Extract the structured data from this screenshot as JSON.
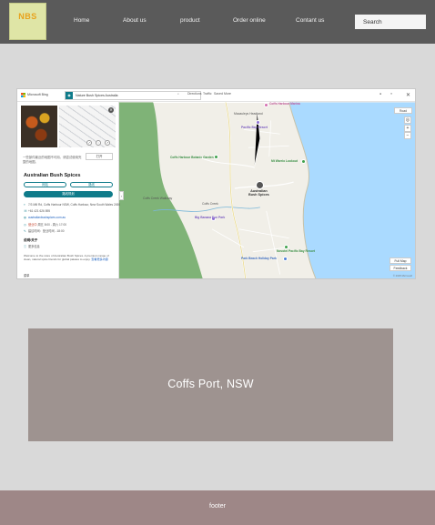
{
  "nav": {
    "logo_text": "NBS",
    "links": [
      "Home",
      "About us",
      "product",
      "Order online",
      "Contant us"
    ],
    "search_placeholder": "Search"
  },
  "map": {
    "brand": "Microsoft Bing",
    "search_text": "Nature Bush Spices Australia",
    "toolbar": [
      "Directions",
      "Traffic",
      "Saved",
      "More"
    ],
    "panel": {
      "note": "一些部件最近的地图不可用。请尝试使用完整的地图。",
      "note_button": "打开",
      "title": "Australian Bush Spices",
      "pill_left": "网站",
      "pill_right": "路线",
      "route_button": "路线规划",
      "address": "7/3 Mill Rd, Coffs Harbour NSW, Coffs Harbour, New South Wales 2450",
      "phone": "+61 421 626 895",
      "website": "australianbushspices.com.au",
      "hours_status": "营业中",
      "hours": "周五 8:00 - 周六 17:00",
      "extra": "建议时间：营业时间 - 18:00",
      "section_heading": "说明/关于",
      "section_sub": "更多信息",
      "description": "Welcome to the store of Australian Bush Spices. A premium range of clean, natural spice blends for global palates to enjoy.",
      "description_link": "查看更多内容",
      "footer": "菜单"
    },
    "collapse": "‹",
    "layer_button": "Road",
    "zoom_in": "+",
    "zoom_out": "−",
    "bottom_buttons": [
      "Full Map",
      "Feedback"
    ],
    "copyright": "© 2025 Microsoft",
    "labels": {
      "headland": "Macauleys Headland",
      "creek": "Coffs Creek",
      "trail": "Coffs Creek Walkway",
      "marina": "Coffs Harbour Marina",
      "lookout": "Mt Warrio Lookout",
      "botanic": "Coffs Harbour Botanic Garden",
      "spices_line1": "Australian",
      "spices_line2": "Bush Spices",
      "campus": "Big Banana Fun Park",
      "beach": "Park Beach Holiday Park",
      "hotel": "Pacific Bay Resort",
      "coast": "Novotel Pacific Bay Resort"
    }
  },
  "location": {
    "text": "Coffs Port, NSW"
  },
  "footer": {
    "text": "footer"
  }
}
